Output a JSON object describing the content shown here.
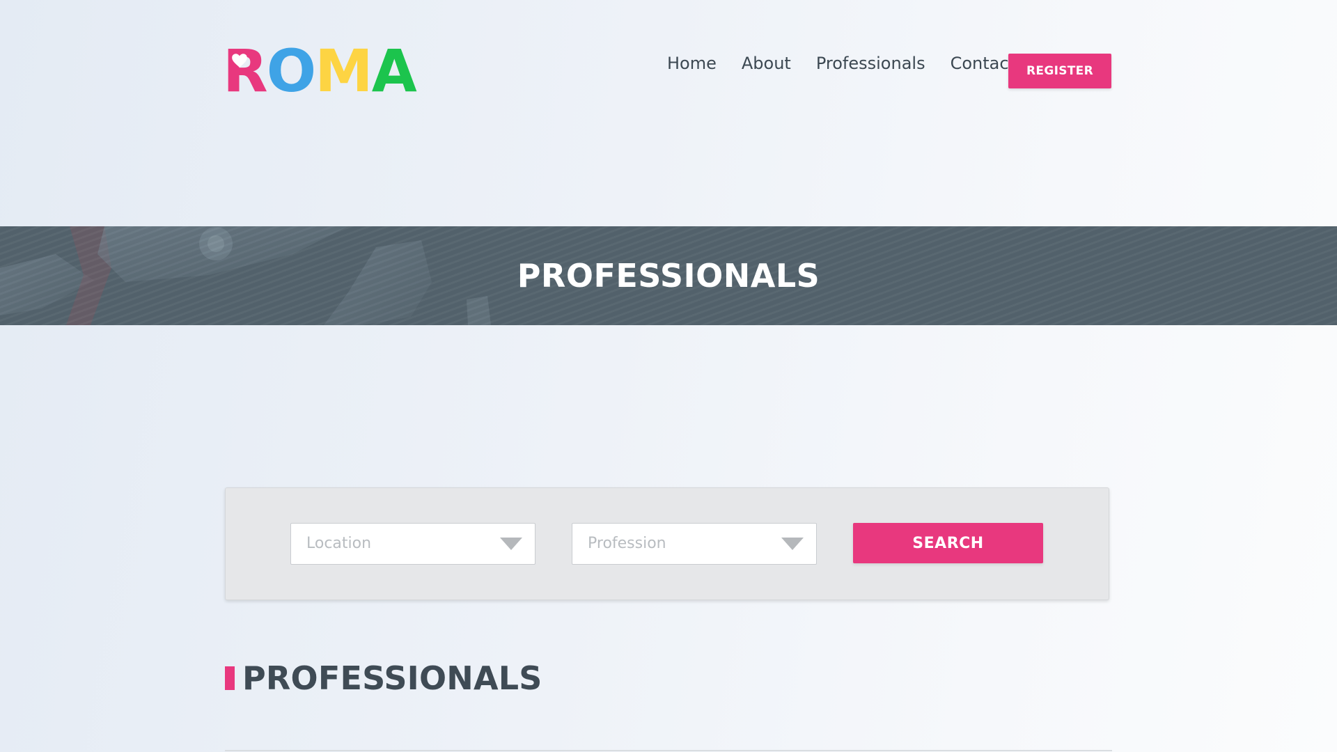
{
  "brand": {
    "logo_letters": [
      "R",
      "O",
      "M",
      "A"
    ],
    "colors": {
      "pink": "#e8387e",
      "blue": "#3fa3e6",
      "yellow": "#fdd443",
      "green": "#1cc44d"
    }
  },
  "nav": {
    "items": [
      {
        "label": "Home"
      },
      {
        "label": "About"
      },
      {
        "label": "Professionals"
      },
      {
        "label": "Contact"
      }
    ],
    "register_label": "REGISTER"
  },
  "hero": {
    "title": "PROFESSIONALS"
  },
  "search": {
    "location_placeholder": "Location",
    "profession_placeholder": "Profession",
    "button_label": "SEARCH"
  },
  "section": {
    "title": "PROFESSIONALS"
  },
  "icons": {
    "logo_heart": "heart-icon",
    "dropdown_caret": "caret-down-icon"
  }
}
